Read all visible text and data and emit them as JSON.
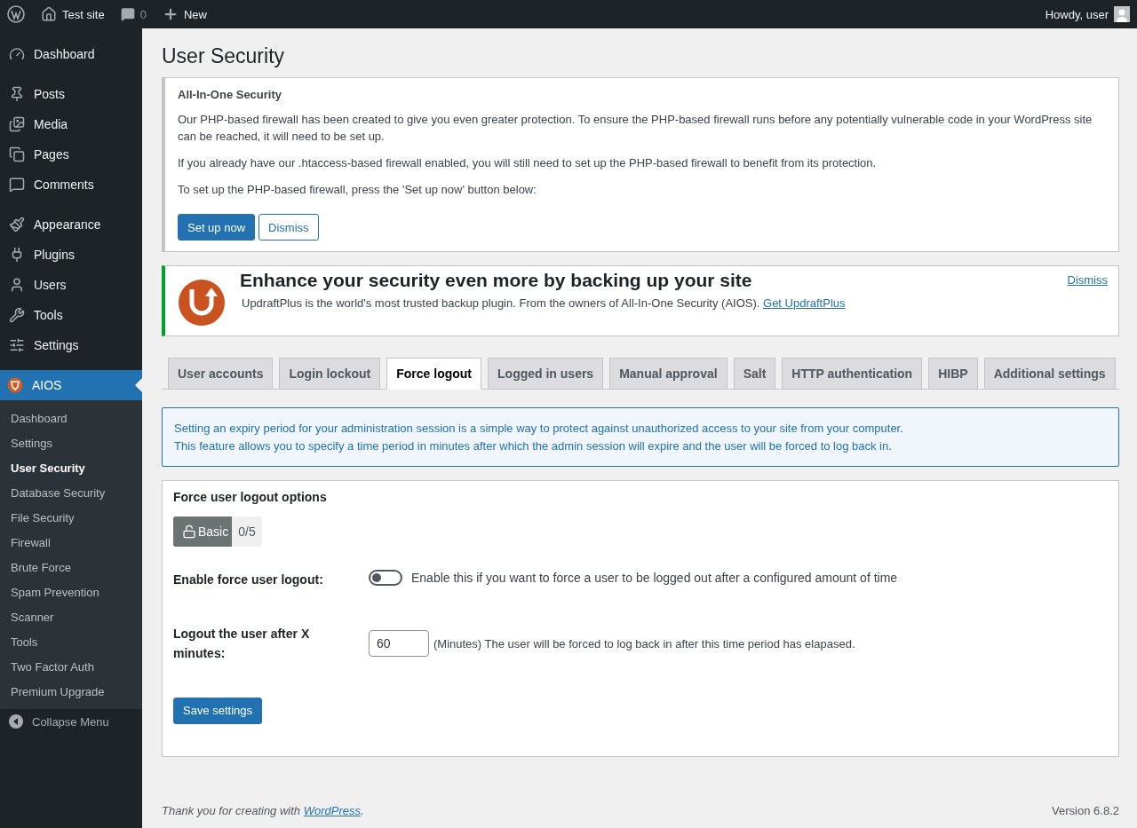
{
  "admin_bar": {
    "site": "Test site",
    "comments": "0",
    "new": "New",
    "greeting": "Howdy, user"
  },
  "sidebar": {
    "groups": [
      [
        {
          "label": "Dashboard"
        }
      ],
      [
        {
          "label": "Posts"
        },
        {
          "label": "Media"
        },
        {
          "label": "Pages"
        },
        {
          "label": "Comments"
        }
      ],
      [
        {
          "label": "Appearance"
        },
        {
          "label": "Plugins"
        },
        {
          "label": "Users"
        },
        {
          "label": "Tools"
        },
        {
          "label": "Settings"
        }
      ]
    ],
    "current": {
      "label": "AIOS",
      "selected": true,
      "submenu": [
        {
          "label": "Dashboard",
          "selected": false
        },
        {
          "label": "Settings",
          "selected": false
        },
        {
          "label": "User Security",
          "selected": true
        },
        {
          "label": "Database Security",
          "selected": false
        },
        {
          "label": "File Security",
          "selected": false
        },
        {
          "label": "Firewall",
          "selected": false
        },
        {
          "label": "Brute Force",
          "selected": false
        },
        {
          "label": "Spam Prevention",
          "selected": false
        },
        {
          "label": "Scanner",
          "selected": false
        },
        {
          "label": "Tools",
          "selected": false
        },
        {
          "label": "Two Factor Auth",
          "selected": false
        },
        {
          "label": "Premium Upgrade",
          "selected": false
        }
      ]
    },
    "collapse": "Collapse Menu"
  },
  "page_title": "User Security",
  "firewall_notice": {
    "title": "All-In-One Security",
    "paragraphs": [
      "Our PHP-based firewall has been created to give you even greater protection. To ensure the PHP-based firewall runs before any potentially vulnerable code in your WordPress site can be reached, it will need to be set up.",
      "If you already have our .htaccess-based firewall enabled, you will still need to set up the PHP-based firewall to benefit from its protection.",
      "To set up the PHP-based firewall, press the 'Set up now' button below:"
    ],
    "primary_button": "Set up now",
    "secondary_button": "Dismiss"
  },
  "backup_notice": {
    "title": "Enhance your security even more by backing up your site",
    "text": "UpdraftPlus is the world's most trusted backup plugin. From the owners of All-In-One Security (AIOS).",
    "link": "Get UpdraftPlus",
    "dismiss": "Dismiss"
  },
  "tabs": [
    {
      "label": "User accounts",
      "selected": false
    },
    {
      "label": "Login lockout",
      "selected": false
    },
    {
      "label": "Force logout",
      "selected": true
    },
    {
      "label": "Logged in users",
      "selected": false
    },
    {
      "label": "Manual approval",
      "selected": false
    },
    {
      "label": "Salt",
      "selected": false
    },
    {
      "label": "HTTP authentication",
      "selected": false
    },
    {
      "label": "HIBP",
      "selected": false
    },
    {
      "label": "Additional settings",
      "selected": false
    }
  ],
  "info_box": [
    "Setting an expiry period for your administration session is a simple way to protect against unauthorized access to your site from your computer.",
    "This feature allows you to specify a time period in minutes after which the admin session will expire and the user will be forced to log back in."
  ],
  "options_panel": {
    "title": "Force user logout options",
    "badge": {
      "label": "Basic",
      "score": "0/5"
    },
    "enable_row": {
      "label": "Enable force user logout:",
      "on": false,
      "description": "Enable this if you want to force a user to be logged out after a configured amount of time"
    },
    "minutes_row": {
      "label": "Logout the user after X minutes:",
      "value": "60",
      "description": "(Minutes) The user will be forced to log back in after this time period has elapased."
    },
    "save_button": "Save settings"
  },
  "footer": {
    "text": "Thank you for creating with",
    "link": "WordPress",
    "end": ".",
    "version": "Version 6.8.2"
  }
}
